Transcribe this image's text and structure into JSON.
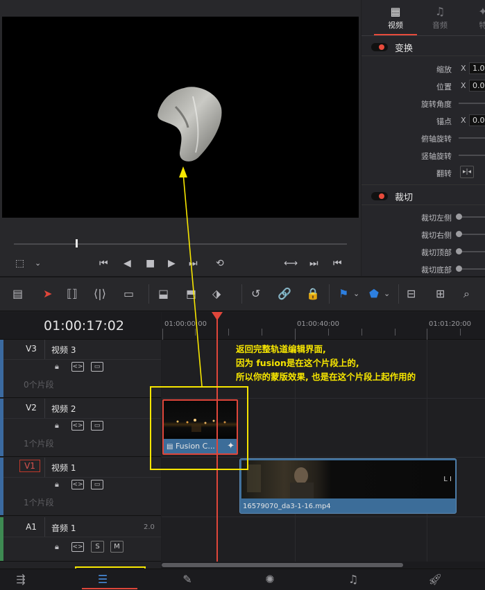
{
  "viewer": {
    "transport": [
      "⏮",
      "◀",
      "■",
      "▶",
      "⏭",
      "⟲"
    ],
    "right_controls": [
      "⟷",
      "⏭",
      "⏮"
    ]
  },
  "inspector": {
    "tabs": [
      {
        "label": "视频",
        "icon": "film-icon",
        "glyph": "▦",
        "active": true
      },
      {
        "label": "音频",
        "icon": "music-note-icon",
        "glyph": "♫",
        "active": false
      },
      {
        "label": "特",
        "icon": "effects-icon",
        "glyph": "✦",
        "active": false
      }
    ],
    "transform": {
      "title": "变换",
      "rows": [
        {
          "label": "缩放",
          "axis": "X",
          "value": "1.0"
        },
        {
          "label": "位置",
          "axis": "X",
          "value": "0.0"
        },
        {
          "label": "旋转角度"
        },
        {
          "label": "锚点",
          "axis": "X",
          "value": "0.0"
        },
        {
          "label": "俯轴旋转"
        },
        {
          "label": "竖轴旋转"
        },
        {
          "label": "翻转"
        }
      ]
    },
    "crop": {
      "title": "裁切",
      "rows": [
        {
          "label": "裁切左侧"
        },
        {
          "label": "裁切右侧"
        },
        {
          "label": "裁切顶部"
        },
        {
          "label": "裁切底部"
        }
      ]
    }
  },
  "timeline": {
    "timecode": "01:00:17:02",
    "ruler": [
      "01:00:00:00",
      "01:00:40:00",
      "01:01:20:00"
    ],
    "tracks": [
      {
        "id": "V3",
        "name": "视频 3",
        "count": "0个片段"
      },
      {
        "id": "V2",
        "name": "视频 2",
        "count": "1个片段"
      },
      {
        "id": "V1",
        "name": "视频 1",
        "count": "1个片段"
      },
      {
        "id": "A1",
        "name": "音频 1",
        "level": "2.0",
        "s": "S",
        "m": "M"
      }
    ],
    "clips": {
      "fusion": "Fusion C...",
      "video": "16579070_da3-1-16.mp4",
      "video_mark": "L I"
    }
  },
  "annotation": {
    "line1": "返回完整轨道编辑界面,",
    "line2": "因为 fusion是在这个片段上的,",
    "line3": "所以你的蒙版效果, 也是在这个片段上起作用的"
  },
  "colors": {
    "accent_red": "#e0463a",
    "annotation_yellow": "#f7e600",
    "clip_blue": "#3c6d99"
  }
}
